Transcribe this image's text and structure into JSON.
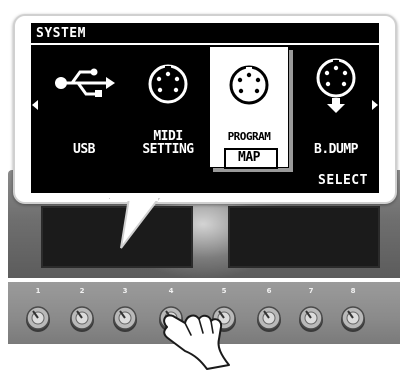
{
  "screen": {
    "title": "SYSTEM",
    "soft_key": "SELECT"
  },
  "menu": [
    {
      "id": "usb",
      "label_line1": "",
      "label_line2": "USB",
      "icon": "usb-icon"
    },
    {
      "id": "midi-setting",
      "label_line1": "MIDI",
      "label_line2": "SETTING",
      "icon": "midi-din-connector-icon"
    },
    {
      "id": "program-map",
      "label_line1": "PROGRAM",
      "label_line2": "MAP",
      "icon": "midi-din-connector-icon",
      "selected": true
    },
    {
      "id": "bulk-dump",
      "label_line1": "",
      "label_line2": "B.DUMP",
      "icon": "midi-din-with-down-arrow-icon"
    }
  ],
  "device": {
    "knob_numbers": [
      "1",
      "2",
      "3",
      "4",
      "5",
      "6",
      "7",
      "8"
    ],
    "touched_knob": "4"
  },
  "colors": {
    "lcd_background": "#000000",
    "lcd_foreground": "#ffffff",
    "panel": "#6f6f6f",
    "knob_strip": "#8a8a8a"
  }
}
